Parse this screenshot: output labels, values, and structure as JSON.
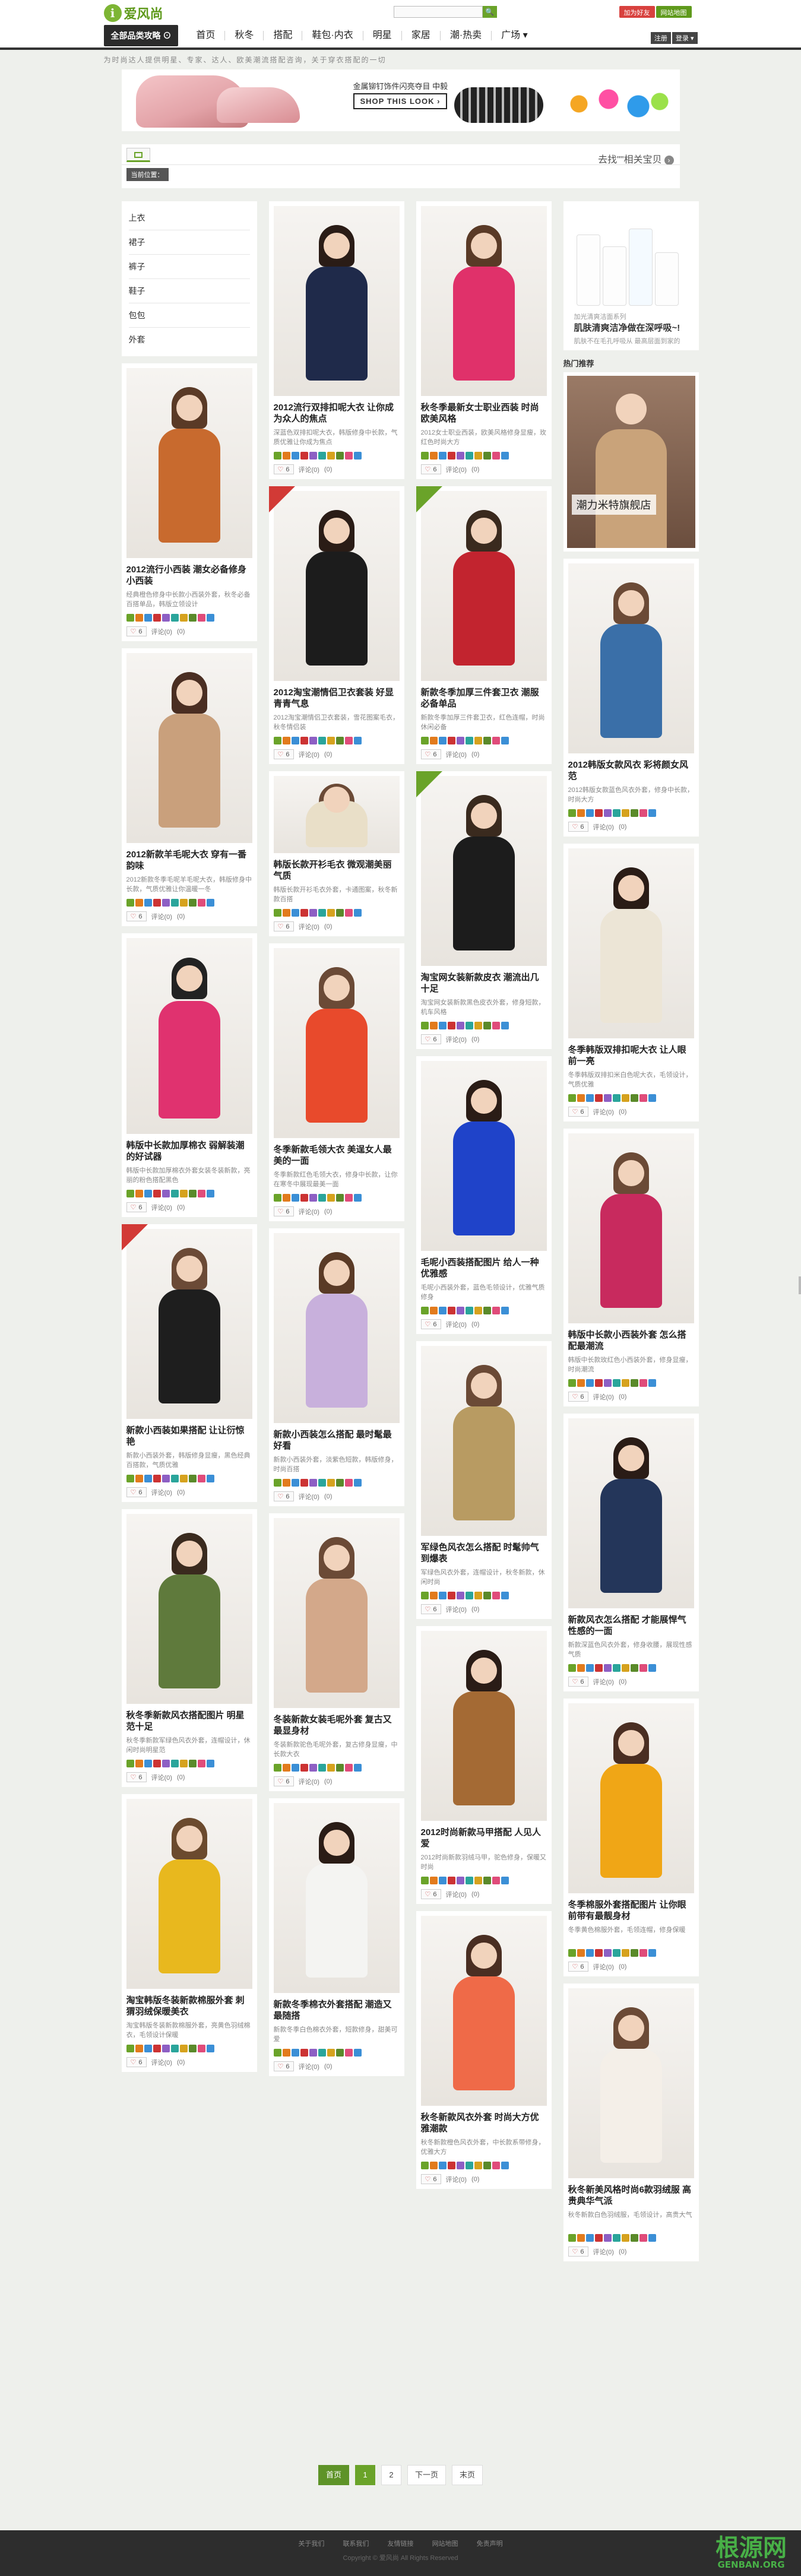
{
  "header": {
    "logo_mark": "i",
    "logo_text": "爱风尚",
    "logo_url": "WWW.ILOVEFS.COM",
    "search_placeholder": "",
    "search_btn": "🔍",
    "btn_register": "加为好友",
    "btn_login": "网站地图"
  },
  "nav": {
    "dropdown": "全部品类攻略 ⊙",
    "items": [
      "首页",
      "秋冬",
      "搭配",
      "鞋包·内衣",
      "明星",
      "家居",
      "潮·热卖",
      "广场 ▾"
    ],
    "right_mini": [
      "注册",
      "登录 ▾"
    ],
    "tagline": "为时尚达人提供明星、专家、达人、欧美潮流搭配咨询，关于穿衣搭配的一切"
  },
  "banner": {
    "title": "金属铆钉饰件闪亮夺目 中毅",
    "shop": "SHOP THIS LOOK ›"
  },
  "filter": {
    "more": "去找\"\"相关宝贝",
    "more_icon": "›",
    "current": "当前位置："
  },
  "categories": [
    "上衣",
    "裙子",
    "裤子",
    "鞋子",
    "包包",
    "外套"
  ],
  "card_common": {
    "comment": "评论(",
    "like": "♡",
    "share": "分享"
  },
  "col1": [
    {
      "title": "2012流行小西装 潮女必备修身小西装",
      "desc": "经典橙色修身中长款小西装外套，秋冬必备百搭单品，韩版立领设计",
      "likes": "6",
      "comments": "0",
      "shares": "(0)"
    },
    {
      "title": "2012新款羊毛呢大衣 穿有一番韵味",
      "desc": "2012新款冬季毛呢羊毛呢大衣，韩版修身中长款，气质优雅让你温暖一冬",
      "likes": "6",
      "comments": "0",
      "shares": "(0)"
    },
    {
      "title": "韩版中长款加厚棉衣 弱解装潮的好试器",
      "desc": "韩版中长款加厚棉衣外套女装冬装新款，亮丽的粉色搭配黑色",
      "likes": "6",
      "comments": "0",
      "shares": "(0)"
    },
    {
      "title": "新款小西装如果搭配 让让衍惊艳",
      "desc": "新款小西装外套，韩版修身显瘦，黑色经典百搭款，气质优雅",
      "likes": "6",
      "comments": "0",
      "shares": "(0)"
    },
    {
      "title": "秋冬季新款风衣搭配图片 明星范十足",
      "desc": "秋冬季新款军绿色风衣外套，连帽设计，休闲时尚明星范",
      "likes": "6",
      "comments": "0",
      "shares": "(0)"
    },
    {
      "title": "淘宝韩版冬装新款棉服外套 刺猬羽绒保暖美衣",
      "desc": "淘宝韩版冬装新款棉服外套，亮黄色羽绒棉衣，毛领设计保暖",
      "likes": "6",
      "comments": "0",
      "shares": "(0)"
    }
  ],
  "col2": [
    {
      "title": "2012流行双排扣呢大衣 让你成为众人的焦点",
      "desc": "深蓝色双排扣呢大衣，韩版修身中长款，气质优雅让你成为焦点",
      "likes": "6",
      "comments": "0",
      "shares": "(0)"
    },
    {
      "title": "2012淘宝潮情侣卫衣套装 好显青青气息",
      "desc": "2012淘宝潮情侣卫衣套装，雪花图案毛衣，秋冬情侣装",
      "likes": "6",
      "comments": "0",
      "shares": "(0)"
    },
    {
      "title": "韩版长款开衫毛衣 微观潮美丽气质",
      "desc": "韩版长款开衫毛衣外套，卡通图案，秋冬新款百搭",
      "likes": "6",
      "comments": "0",
      "shares": "(0)"
    },
    {
      "title": "冬季新款毛领大衣 美逞女人最美的一面",
      "desc": "冬季新款红色毛领大衣，修身中长款，让你在寒冬中展现最美一面",
      "likes": "6",
      "comments": "0",
      "shares": "(0)"
    },
    {
      "title": "新款小西装怎么搭配 最时髦最好看",
      "desc": "新款小西装外套，淡紫色短款，韩版修身，时尚百搭",
      "likes": "6",
      "comments": "0",
      "shares": "(0)"
    },
    {
      "title": "冬装新款女装毛呢外套 复古又最显身材",
      "desc": "冬装新款驼色毛呢外套，复古修身显瘦，中长款大衣",
      "likes": "6",
      "comments": "0",
      "shares": "(0)"
    },
    {
      "title": "新款冬季棉衣外套搭配 潮造又最随搭",
      "desc": "新款冬季白色棉衣外套，短款修身，甜美可爱",
      "likes": "6",
      "comments": "0",
      "shares": "(0)"
    }
  ],
  "col3": [
    {
      "title": "秋冬季最新女士职业西装 时尚欧美风格",
      "desc": "2012女士职业西装，欧美风格修身显瘦，玫红色时尚大方",
      "likes": "6",
      "comments": "0",
      "shares": "(0)"
    },
    {
      "title": "新款冬季加厚三件套卫衣 潮服必备单品",
      "desc": "新款冬季加厚三件套卫衣，红色连帽，时尚休闲必备",
      "likes": "6",
      "comments": "0",
      "shares": "(0)"
    },
    {
      "title": "淘宝网女装新款皮衣 潮流出几十足",
      "desc": "淘宝网女装新款黑色皮衣外套，修身短款，机车风格",
      "likes": "6",
      "comments": "0",
      "shares": "(0)"
    },
    {
      "title": "毛呢小西装搭配图片 给人一种优雅感",
      "desc": "毛呢小西装外套，蓝色毛领设计，优雅气质修身",
      "likes": "6",
      "comments": "0",
      "shares": "(0)"
    },
    {
      "title": "军绿色风衣怎么搭配 时髦帅气到爆表",
      "desc": "军绿色风衣外套，连帽设计，秋冬新款，休闲时尚",
      "likes": "6",
      "comments": "0",
      "shares": "(0)"
    },
    {
      "title": "2012时尚新款马甲搭配 人见人爱",
      "desc": "2012时尚新款羽绒马甲，驼色修身，保暖又时尚",
      "likes": "6",
      "comments": "0",
      "shares": "(0)"
    },
    {
      "title": "秋冬新款风衣外套 时尚大方优雅潮款",
      "desc": "秋冬新款橙色风衣外套，中长款系带修身，优雅大方",
      "likes": "6",
      "comments": "0",
      "shares": "(0)"
    }
  ],
  "col4_ad": {
    "brand": "加光清爽洁面系列",
    "title": "肌肤清爽洁净做在深呼吸~!",
    "caption": "肌肤不在毛孔呼吸从 最高层面到家的",
    "hot": "热门推荐",
    "promo": "潮力米特旗舰店"
  },
  "col4": [
    {
      "title": "2012韩版女款风衣 彩将颜女风范",
      "desc": "2012韩版女款蓝色风衣外套，修身中长款，时尚大方",
      "likes": "6",
      "comments": "0",
      "shares": "(0)"
    },
    {
      "title": "冬季韩版双排扣呢大衣 让人眼前一亮",
      "desc": "冬季韩版双排扣米白色呢大衣，毛领设计，气质优雅",
      "likes": "6",
      "comments": "0",
      "shares": "(0)"
    },
    {
      "title": "韩版中长款小西装外套 怎么搭配最潮流",
      "desc": "韩版中长款玫红色小西装外套，修身显瘦，时尚潮流",
      "likes": "6",
      "comments": "0",
      "shares": "(0)"
    },
    {
      "title": "新款风衣怎么搭配 才能展悍气性感的一面",
      "desc": "新款深蓝色风衣外套，修身收腰，展现性感气质",
      "likes": "6",
      "comments": "0",
      "shares": "(0)"
    },
    {
      "title": "冬季棉服外套搭配图片 让你眼前带有最靓身材",
      "desc": "冬季黄色棉服外套，毛领连帽，修身保暖",
      "likes": "6",
      "comments": "0",
      "shares": "(0)"
    },
    {
      "title": "秋冬新美风格时尚6款羽绒服 高贵典华气派",
      "desc": "秋冬新款白色羽绒服，毛领设计，高贵大气",
      "likes": "6",
      "comments": "0",
      "shares": "(0)"
    }
  ],
  "pager": [
    "首页",
    "1",
    "2",
    "下一页",
    "末页"
  ],
  "footer": {
    "links": [
      "关于我们",
      "联系我们",
      "友情链接",
      "网站地图",
      "免责声明"
    ],
    "copy": "Copyright © 爱风尚 All Rights Reserved",
    "wm_main": "根源网",
    "wm_sub": "GENBAN.ORG"
  },
  "colors": {
    "accent_green": "#6aa329",
    "hot_red": "#d23a36",
    "bg": "#eef0ec"
  }
}
